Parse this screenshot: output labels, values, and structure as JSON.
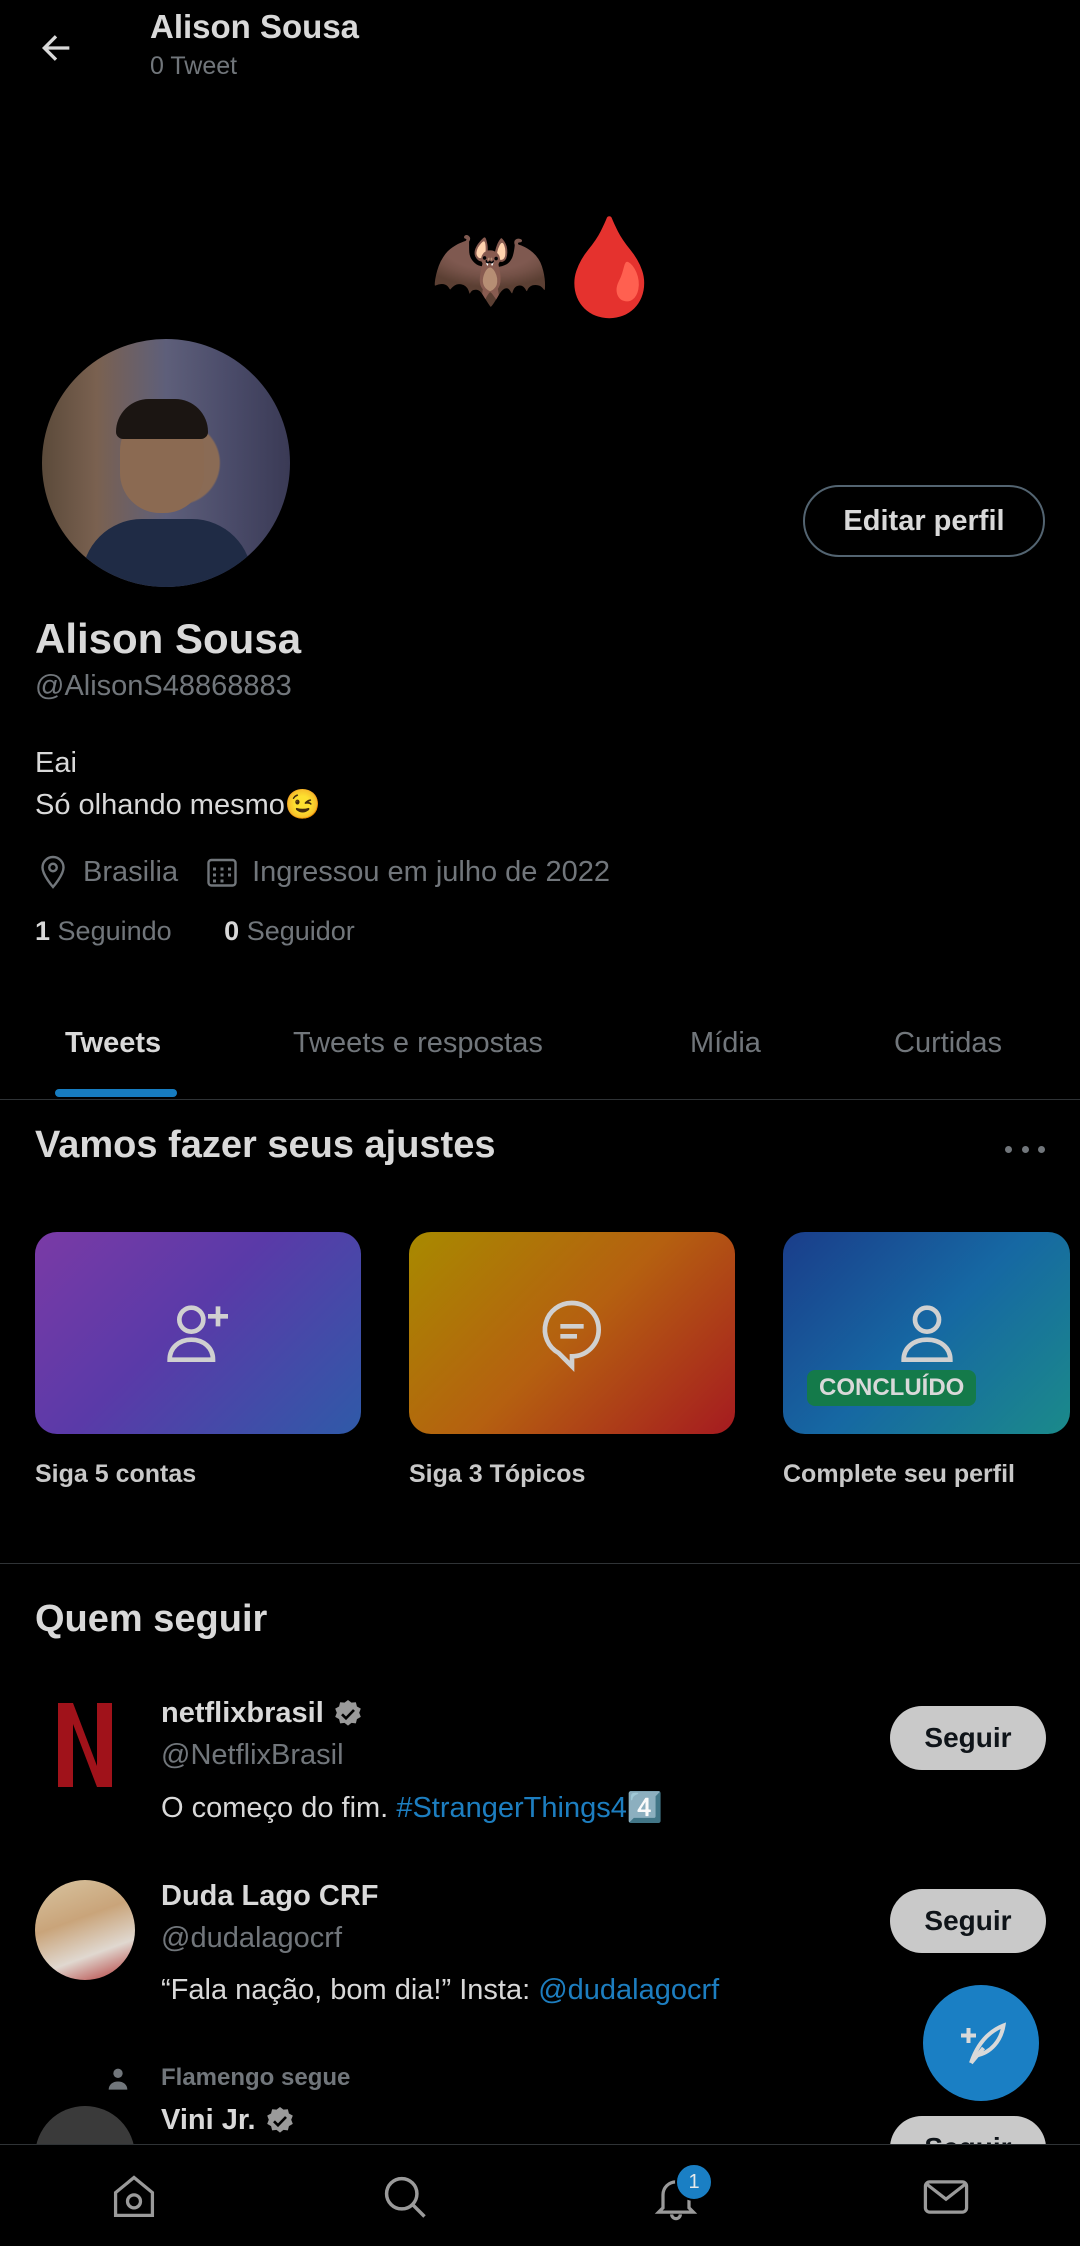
{
  "header": {
    "title": "Alison Sousa",
    "subtitle": "0 Tweet"
  },
  "banner": {
    "emoji": "🦇🩸"
  },
  "profile": {
    "edit_label": "Editar perfil",
    "name": "Alison Sousa",
    "handle": "@AlisonS48868883",
    "bio_line1": "Eai",
    "bio_line2": "Só olhando mesmo😉",
    "location": "Brasilia",
    "joined": "Ingressou em julho de 2022",
    "following_count": "1",
    "following_label": "Seguindo",
    "followers_count": "0",
    "followers_label": "Seguidor"
  },
  "tabs": [
    {
      "label": "Tweets"
    },
    {
      "label": "Tweets e respostas"
    },
    {
      "label": "Mídia"
    },
    {
      "label": "Curtidas"
    }
  ],
  "setup": {
    "title": "Vamos fazer seus ajustes",
    "cards": [
      {
        "label": "Siga 5 contas",
        "icon": "person-add-icon"
      },
      {
        "label": "Siga 3 Tópicos",
        "icon": "topic-bubble-icon"
      },
      {
        "label": "Complete seu perfil",
        "icon": "person-icon",
        "badge": "CONCLUÍDO"
      }
    ]
  },
  "who_to_follow": {
    "title": "Quem seguir",
    "follow_label": "Seguir",
    "accounts": [
      {
        "name": "netflixbrasil",
        "handle": "@NetflixBrasil",
        "bio": "O começo do fim. ",
        "bio_link": "#StrangerThings4",
        "bio_tail": "4️⃣"
      },
      {
        "name": "Duda Lago CRF",
        "handle": "@dudalagocrf",
        "bio": "“Fala nação, bom dia!” Insta: ",
        "bio_link": "@dudalagocrf"
      },
      {
        "context": "Flamengo segue",
        "name": "Vini Jr."
      }
    ]
  },
  "notifications": {
    "count": "1"
  },
  "colors": {
    "accent": "#1d9bf0",
    "background": "#000000"
  }
}
